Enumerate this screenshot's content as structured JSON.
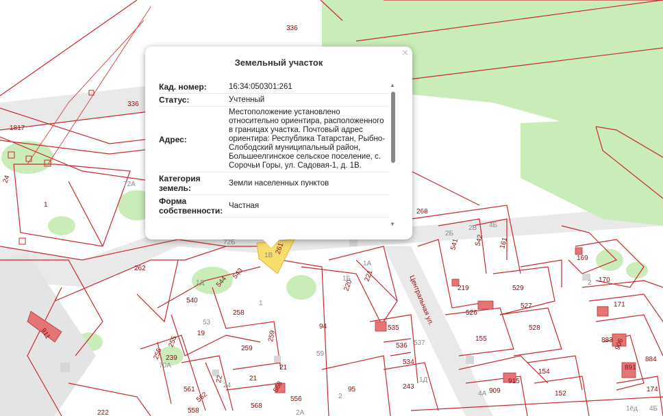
{
  "colors": {
    "parcel_line": "#c8282d",
    "green_area": "#c9ecb8",
    "highlight_fill": "#f7dd6e",
    "road": "#d9d9d9"
  },
  "map": {
    "labels": [
      "336",
      "336",
      "1817",
      "24",
      "72А",
      "1",
      "262",
      "72Б",
      "1В",
      "261",
      "268",
      "2Б",
      "2В",
      "4Б",
      "541",
      "542",
      "161",
      "169",
      "1А",
      "1Б",
      "221",
      "220",
      "544",
      "543",
      "540",
      "1Д",
      "258",
      "53",
      "219",
      "529",
      "527",
      "526",
      "170",
      "2",
      "171",
      "19",
      "255",
      "256",
      "239",
      "70А",
      "259",
      "259",
      "21",
      "21",
      "561",
      "562",
      "22",
      "24",
      "568",
      "568",
      "556",
      "2А",
      "558",
      "94",
      "59",
      "535",
      "536",
      "537",
      "534",
      "1Д",
      "95",
      "243",
      "155",
      "528",
      "883",
      "906",
      "884",
      "891",
      "915",
      "909",
      "4А",
      "154",
      "152",
      "174",
      "222",
      "911",
      "2",
      "Центральная ул.",
      "4Б",
      "1ёд",
      "1"
    ]
  },
  "popup": {
    "title": "Земельный участок",
    "close": "×",
    "rows": [
      {
        "k": "Кад. номер:",
        "v": "16:34:050301:261"
      },
      {
        "k": "Статус:",
        "v": "Учтенный"
      },
      {
        "k": "Адрес:",
        "v": "Местоположение установлено относительно ориентира, расположенного в границах участка. Почтовый адрес ориентира: Республика Татарстан, Рыбно-Слободский муниципальный район, Большеелгинское сельское поселение, с. Сорочьи Горы, ул. Садовая-1, д. 1В."
      },
      {
        "k": "Категория земель:",
        "v": "Земли населенных пунктов"
      },
      {
        "k": "Форма собственности:",
        "v": "Частная"
      }
    ]
  }
}
